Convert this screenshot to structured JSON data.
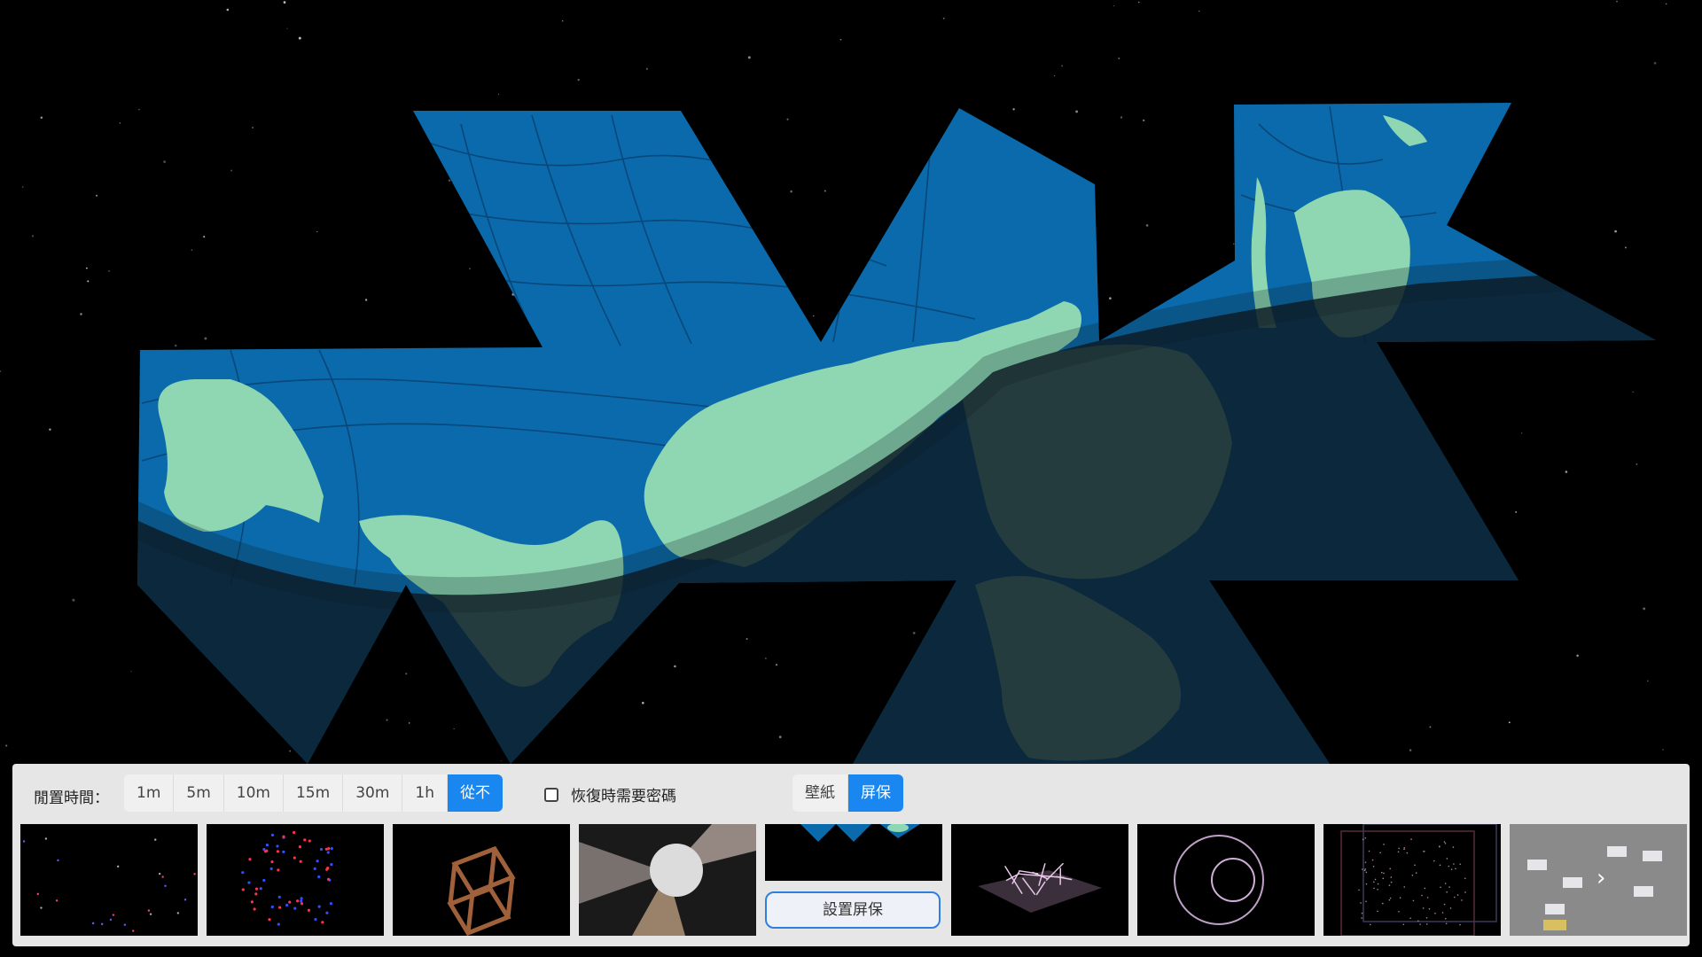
{
  "wallpaper": {
    "name": "dymaxion-earth-map",
    "colors": {
      "ocean": "#0a6aab",
      "land": "#8fd7b2",
      "night": "#0c1a24",
      "sky": "#000000"
    }
  },
  "settings": {
    "idle_label": "閒置時間：",
    "time_options": [
      "1m",
      "5m",
      "10m",
      "15m",
      "30m",
      "1h",
      "從不"
    ],
    "time_selected": "從不",
    "password_checkbox": {
      "label": "恢復時需要密碼",
      "checked": false
    },
    "mode_options": [
      "壁紙",
      "屏保"
    ],
    "mode_selected": "屏保",
    "accent": "#1a86f0"
  },
  "screensavers": {
    "set_button": "設置屏保",
    "items": [
      {
        "name": "starfield-dots"
      },
      {
        "name": "particle-sphere"
      },
      {
        "name": "wire-cube"
      },
      {
        "name": "disco-ball"
      },
      {
        "name": "dymaxion-map"
      },
      {
        "name": "grid-particles"
      },
      {
        "name": "rings"
      },
      {
        "name": "wire-box"
      },
      {
        "name": "more-blocks"
      }
    ]
  }
}
